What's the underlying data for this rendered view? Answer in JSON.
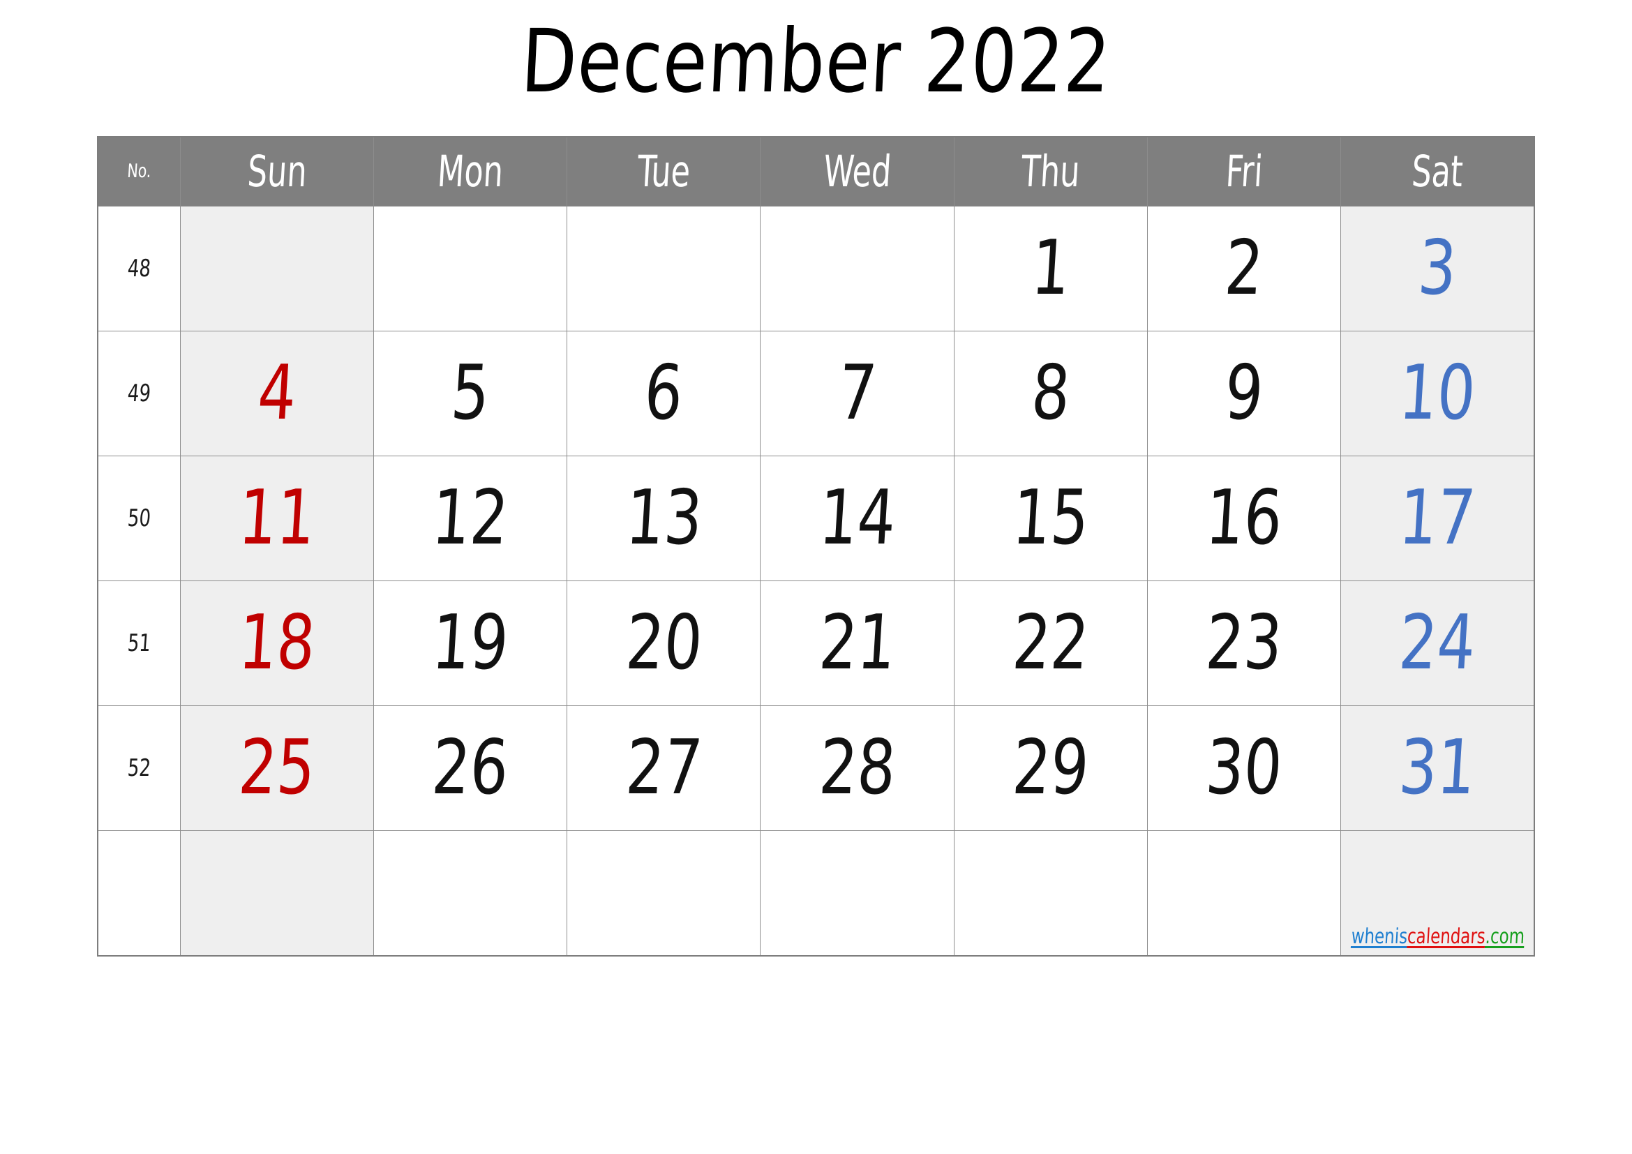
{
  "title": "December 2022",
  "header": {
    "week_no_label": "No.",
    "days": [
      "Sun",
      "Mon",
      "Tue",
      "Wed",
      "Thu",
      "Fri",
      "Sat"
    ]
  },
  "colors": {
    "header_background": "#7f7f7f",
    "header_text": "#ffffff",
    "weekend_cell_background": "#efefef",
    "weekday_text": "#111111",
    "sunday_text": "#c00000",
    "saturday_text": "#4472c4",
    "grid_line": "#8d8d8d"
  },
  "weeks": [
    {
      "no": "48",
      "days": [
        {
          "label": "",
          "kind": "empty"
        },
        {
          "label": "",
          "kind": "empty"
        },
        {
          "label": "",
          "kind": "empty"
        },
        {
          "label": "",
          "kind": "empty"
        },
        {
          "label": "1",
          "kind": "weekday"
        },
        {
          "label": "2",
          "kind": "weekday"
        },
        {
          "label": "3",
          "kind": "saturday"
        }
      ]
    },
    {
      "no": "49",
      "days": [
        {
          "label": "4",
          "kind": "sunday"
        },
        {
          "label": "5",
          "kind": "weekday"
        },
        {
          "label": "6",
          "kind": "weekday"
        },
        {
          "label": "7",
          "kind": "weekday"
        },
        {
          "label": "8",
          "kind": "weekday"
        },
        {
          "label": "9",
          "kind": "weekday"
        },
        {
          "label": "10",
          "kind": "saturday"
        }
      ]
    },
    {
      "no": "50",
      "days": [
        {
          "label": "11",
          "kind": "sunday"
        },
        {
          "label": "12",
          "kind": "weekday"
        },
        {
          "label": "13",
          "kind": "weekday"
        },
        {
          "label": "14",
          "kind": "weekday"
        },
        {
          "label": "15",
          "kind": "weekday"
        },
        {
          "label": "16",
          "kind": "weekday"
        },
        {
          "label": "17",
          "kind": "saturday"
        }
      ]
    },
    {
      "no": "51",
      "days": [
        {
          "label": "18",
          "kind": "sunday"
        },
        {
          "label": "19",
          "kind": "weekday"
        },
        {
          "label": "20",
          "kind": "weekday"
        },
        {
          "label": "21",
          "kind": "weekday"
        },
        {
          "label": "22",
          "kind": "weekday"
        },
        {
          "label": "23",
          "kind": "weekday"
        },
        {
          "label": "24",
          "kind": "saturday"
        }
      ]
    },
    {
      "no": "52",
      "days": [
        {
          "label": "25",
          "kind": "sunday"
        },
        {
          "label": "26",
          "kind": "weekday"
        },
        {
          "label": "27",
          "kind": "weekday"
        },
        {
          "label": "28",
          "kind": "weekday"
        },
        {
          "label": "29",
          "kind": "weekday"
        },
        {
          "label": "30",
          "kind": "weekday"
        },
        {
          "label": "31",
          "kind": "saturday"
        }
      ]
    },
    {
      "no": "",
      "days": [
        {
          "label": "",
          "kind": "empty"
        },
        {
          "label": "",
          "kind": "empty"
        },
        {
          "label": "",
          "kind": "empty"
        },
        {
          "label": "",
          "kind": "empty"
        },
        {
          "label": "",
          "kind": "empty"
        },
        {
          "label": "",
          "kind": "empty"
        },
        {
          "label": "",
          "kind": "empty"
        }
      ]
    }
  ],
  "watermark": {
    "part_a": "whenis",
    "part_b": "calendars",
    "part_c": ".com"
  }
}
